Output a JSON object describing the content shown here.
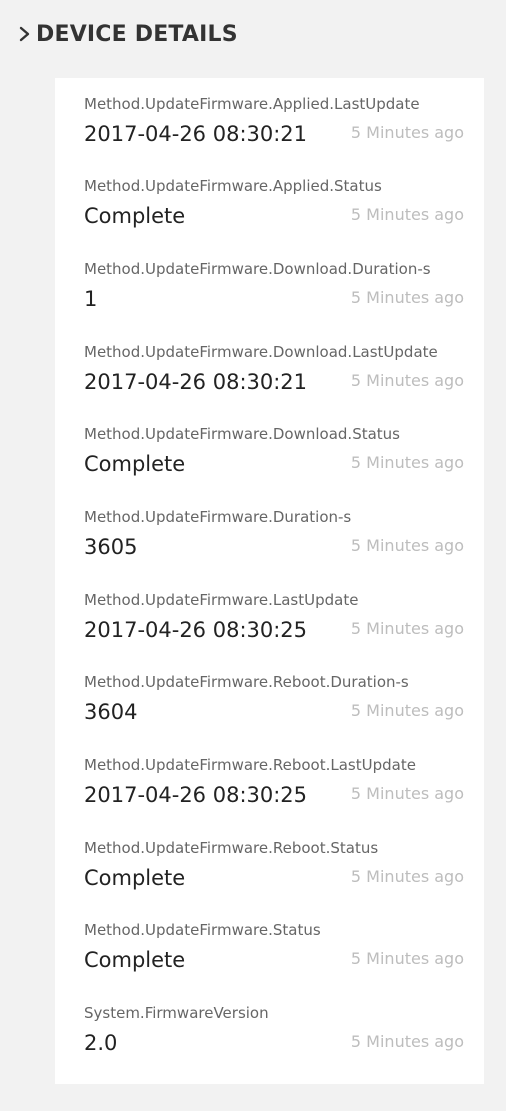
{
  "section": {
    "title": "DEVICE DETAILS",
    "toggle_icon": "chevron-right-icon"
  },
  "properties": [
    {
      "name": "Method.UpdateFirmware.Applied.LastUpdate",
      "value": "2017-04-26 08:30:21",
      "updated": "5 Minutes ago"
    },
    {
      "name": "Method.UpdateFirmware.Applied.Status",
      "value": "Complete",
      "updated": "5 Minutes ago"
    },
    {
      "name": "Method.UpdateFirmware.Download.Duration-s",
      "value": "1",
      "updated": "5 Minutes ago"
    },
    {
      "name": "Method.UpdateFirmware.Download.LastUpdate",
      "value": "2017-04-26 08:30:21",
      "updated": "5 Minutes ago"
    },
    {
      "name": "Method.UpdateFirmware.Download.Status",
      "value": "Complete",
      "updated": "5 Minutes ago"
    },
    {
      "name": "Method.UpdateFirmware.Duration-s",
      "value": "3605",
      "updated": "5 Minutes ago"
    },
    {
      "name": "Method.UpdateFirmware.LastUpdate",
      "value": "2017-04-26 08:30:25",
      "updated": "5 Minutes ago"
    },
    {
      "name": "Method.UpdateFirmware.Reboot.Duration-s",
      "value": "3604",
      "updated": "5 Minutes ago"
    },
    {
      "name": "Method.UpdateFirmware.Reboot.LastUpdate",
      "value": "2017-04-26 08:30:25",
      "updated": "5 Minutes ago"
    },
    {
      "name": "Method.UpdateFirmware.Reboot.Status",
      "value": "Complete",
      "updated": "5 Minutes ago"
    },
    {
      "name": "Method.UpdateFirmware.Status",
      "value": "Complete",
      "updated": "5 Minutes ago"
    },
    {
      "name": "System.FirmwareVersion",
      "value": "2.0",
      "updated": "5 Minutes ago"
    }
  ]
}
